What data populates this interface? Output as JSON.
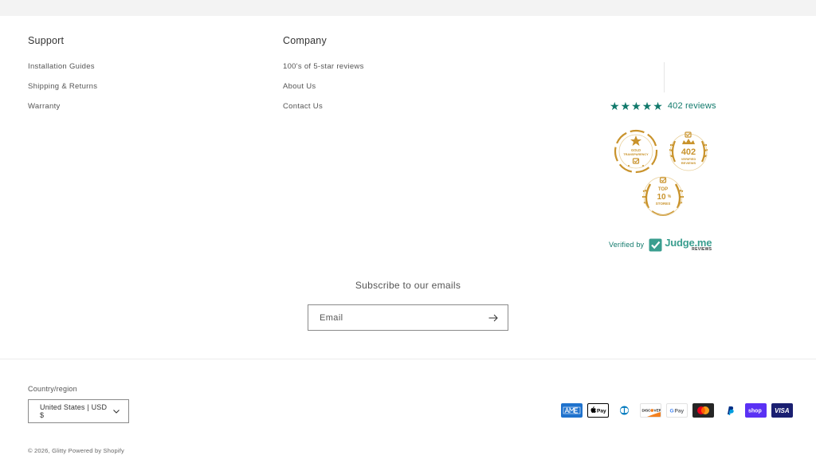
{
  "support": {
    "heading": "Support",
    "links": [
      "Installation Guides",
      "Shipping & Returns",
      "Warranty"
    ]
  },
  "company": {
    "heading": "Company",
    "links": [
      "100's of 5-star reviews",
      "About Us",
      "Contact Us"
    ]
  },
  "reviews": {
    "rating": 5,
    "count_text": "402 reviews",
    "star_color": "#10796b"
  },
  "badges": {
    "gold": {
      "line1": "GOLD",
      "line2": "TRANSPARENCY"
    },
    "verified": {
      "number": "402",
      "line1": "VERIFIED",
      "line2": "REVIEWS"
    },
    "top": {
      "line1": "TOP",
      "number": "10",
      "unit": "%",
      "line2": "STORES"
    },
    "color": "#c9932c"
  },
  "verified_by": {
    "label": "Verified by",
    "brand": "Judge.me",
    "brand_sub": "REVIEWS"
  },
  "newsletter": {
    "title": "Subscribe to our emails",
    "email_placeholder": "Email",
    "submit_icon": "arrow-right-icon"
  },
  "localization": {
    "label": "Country/region",
    "selected": "United States | USD $"
  },
  "payments": [
    {
      "name": "American Express",
      "icon": "amex-icon",
      "color": "#1f72cd"
    },
    {
      "name": "Apple Pay",
      "icon": "apple-pay-icon",
      "color": "#000000"
    },
    {
      "name": "Diners Club",
      "icon": "diners-club-icon",
      "color": "#0079be"
    },
    {
      "name": "Discover",
      "icon": "discover-icon",
      "color": "#f48120"
    },
    {
      "name": "Google Pay",
      "icon": "google-pay-icon",
      "color": "#5f6368"
    },
    {
      "name": "Mastercard",
      "icon": "mastercard-icon",
      "color": "#252525"
    },
    {
      "name": "PayPal",
      "icon": "paypal-icon",
      "color": "#003087"
    },
    {
      "name": "Shop Pay",
      "icon": "shop-pay-icon",
      "color": "#5a31f4"
    },
    {
      "name": "Visa",
      "icon": "visa-icon",
      "color": "#1a1f71"
    }
  ],
  "footer": {
    "copyright": "© 2026,",
    "store_name": "Glitty",
    "powered_by": "Powered by Shopify"
  }
}
